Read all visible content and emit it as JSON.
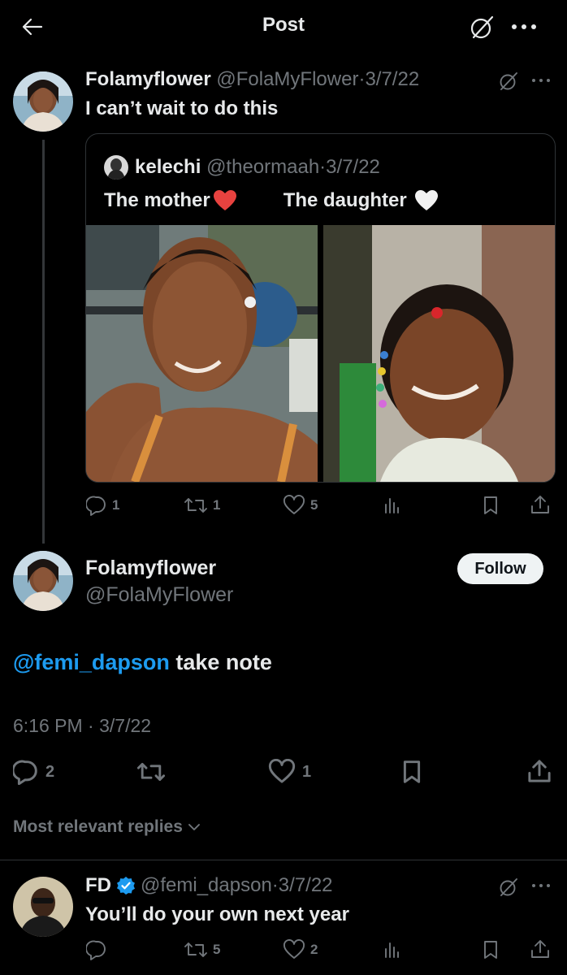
{
  "header": {
    "title": "Post"
  },
  "quoting_tweet": {
    "display_name": "Folamyflower",
    "handle": "@FolaMyFlower",
    "date": "3/7/22",
    "text": "I can’t wait to do this",
    "quoted": {
      "display_name": "kelechi",
      "handle": "@theormaah",
      "date": "3/7/22",
      "caption_left": "The mother",
      "caption_right": "The daughter"
    },
    "actions": {
      "replies": "1",
      "reposts": "1",
      "likes": "5"
    }
  },
  "main_post": {
    "display_name": "Folamyflower",
    "handle": "@FolaMyFlower",
    "follow_label": "Follow",
    "mention": "@femi_dapson",
    "text": "take note",
    "timestamp": "6:16 PM · 3/7/22",
    "actions": {
      "replies": "2",
      "likes": "1"
    }
  },
  "replies_sort": {
    "label": "Most relevant replies"
  },
  "reply": {
    "display_name": "FD",
    "handle": "@femi_dapson",
    "date": "3/7/22",
    "text": "You’ll do your own next year",
    "actions": {
      "reposts": "5",
      "likes": "2"
    }
  },
  "colors": {
    "background": "#000000",
    "text": "#e7e9ea",
    "muted": "#71767b",
    "link": "#1d9bf0",
    "heart": "#f91880"
  }
}
